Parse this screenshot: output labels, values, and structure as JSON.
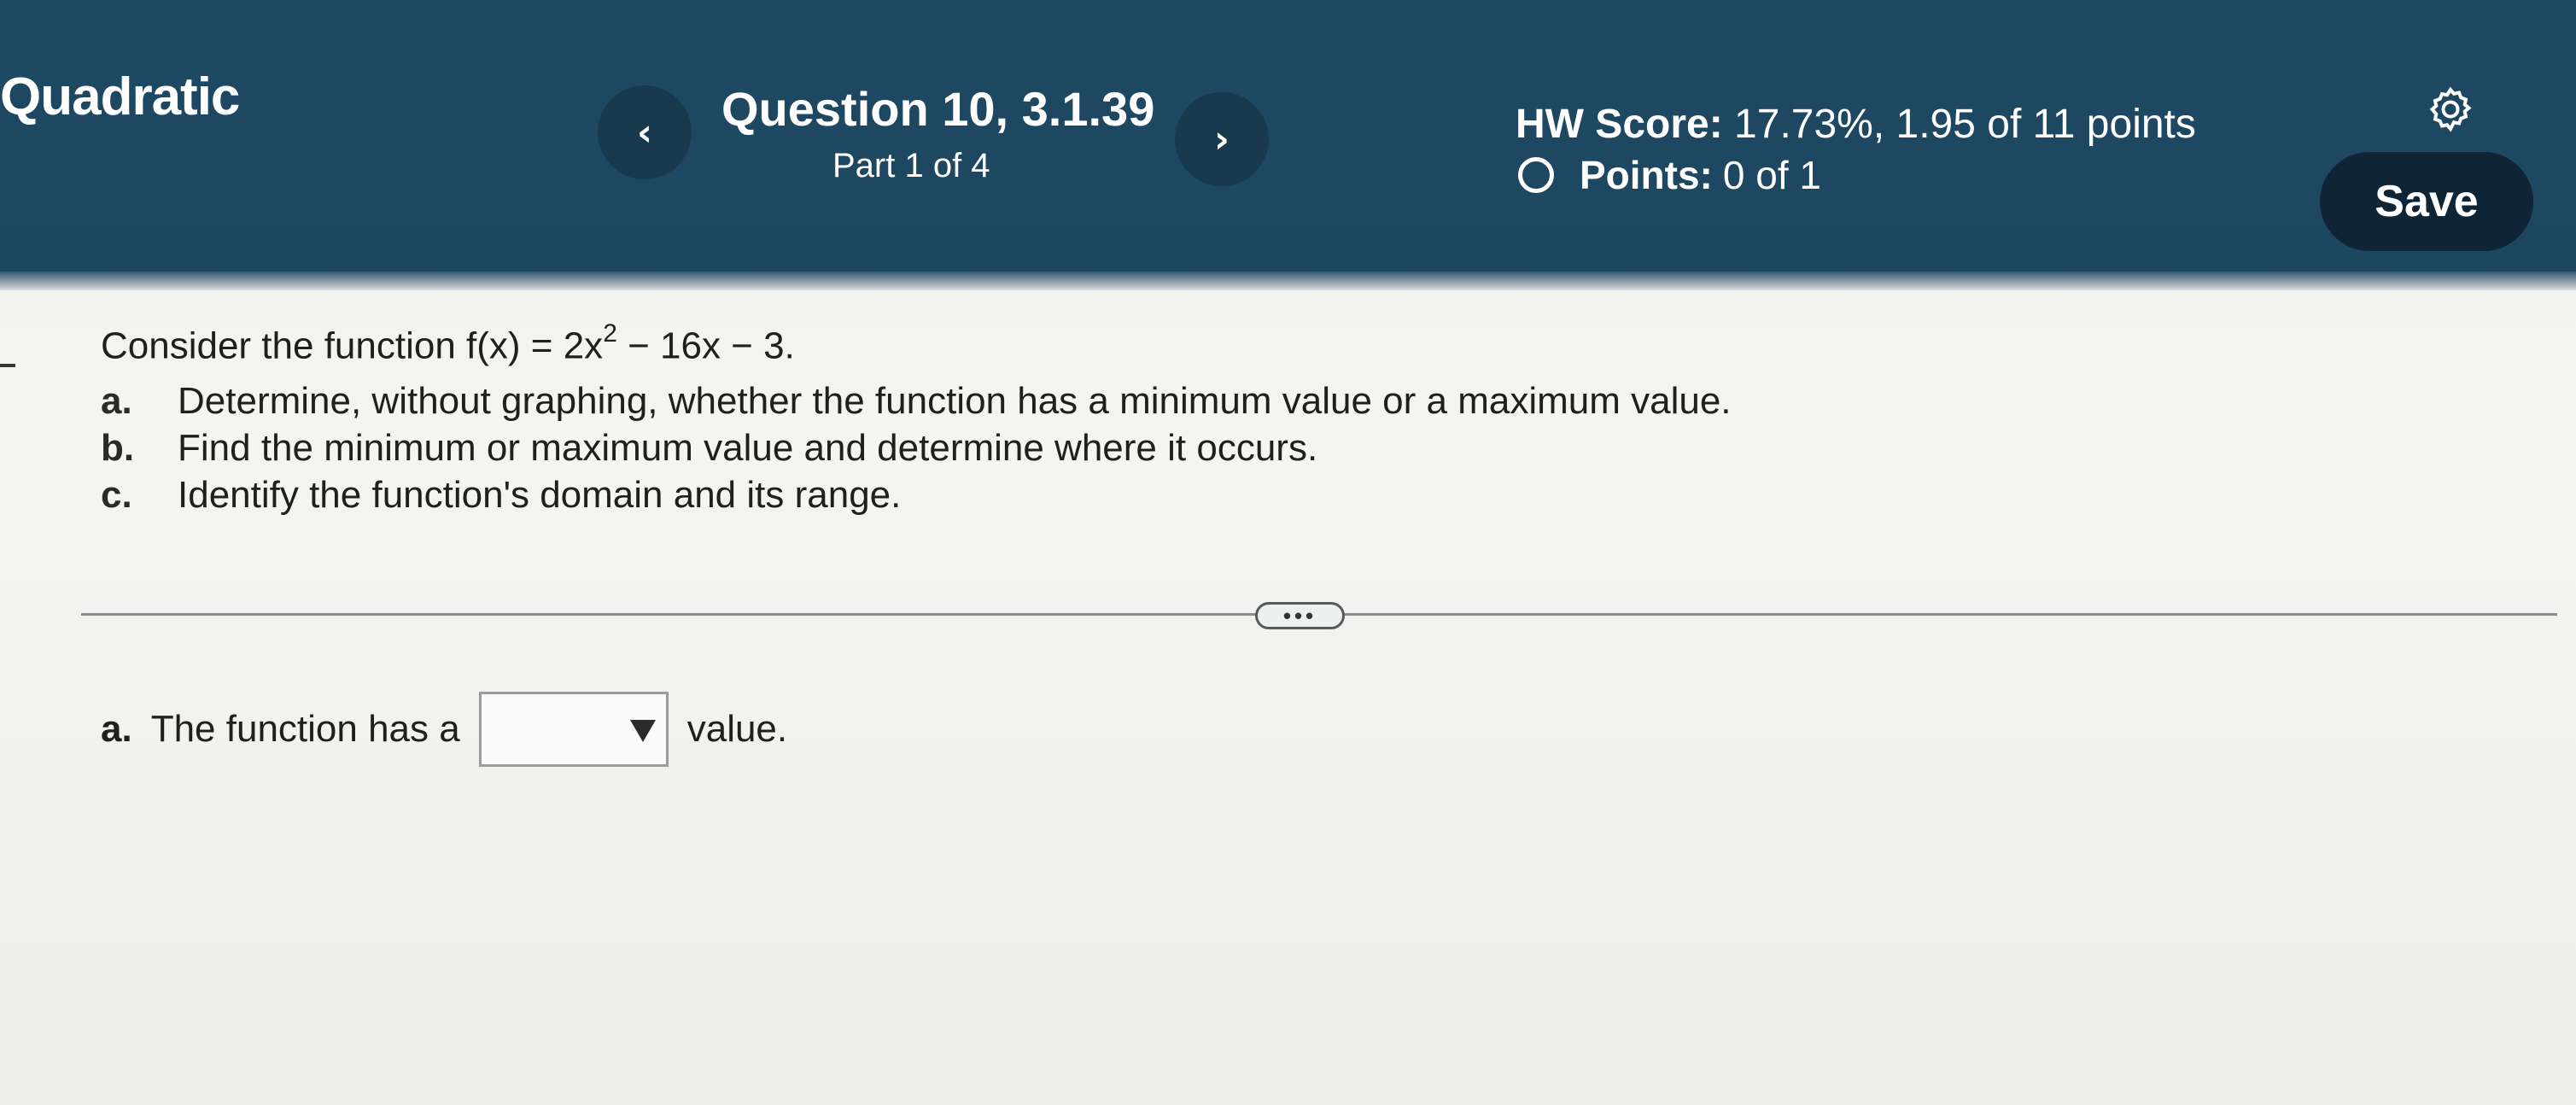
{
  "header": {
    "course_title": "Quadratic",
    "question_title": "Question 10, 3.1.39",
    "question_part": "Part 1 of 4",
    "hw_score_label": "HW Score:",
    "hw_score_value": "17.73%, 1.95 of 11 points",
    "points_label": "Points:",
    "points_value": "0 of 1",
    "prev_icon": "‹",
    "next_icon": "›",
    "save_label": "Save",
    "settings_icon": "gear-icon"
  },
  "question": {
    "prompt_before": "Consider the function f(x) = 2x",
    "prompt_exp": "2",
    "prompt_after": " − 16x − 3.",
    "parts": [
      {
        "letter": "a.",
        "text": "Determine, without graphing, whether the function has a minimum value or a maximum value."
      },
      {
        "letter": "b.",
        "text": "Find the minimum or maximum value and determine where it occurs."
      },
      {
        "letter": "c.",
        "text": "Identify the function's domain and its range."
      }
    ],
    "more_label": "•••"
  },
  "answer": {
    "letter": "a.",
    "before": "The function has a",
    "selected": "",
    "after": "value."
  },
  "colors": {
    "header_bg": "#1f4a63",
    "save_bg": "#0f2535",
    "nav_btn_bg": "#18394e"
  }
}
